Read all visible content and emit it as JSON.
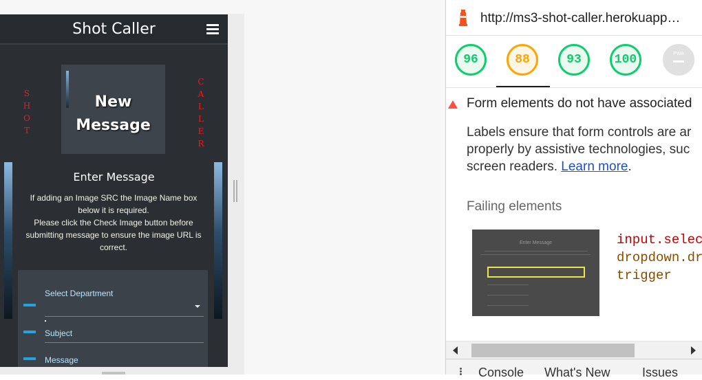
{
  "app": {
    "brand": "Shot Caller",
    "side_left": "SHOT",
    "side_right": "CALLER",
    "card_line1": "New",
    "card_line2": "Message",
    "section_title": "Enter Message",
    "help_line1": "If adding an Image SRC the Image Name box below it is required.",
    "help_line2": "Please click the Check Image button before submitting message to ensure the image URL is correct.",
    "fields": {
      "department_label": "Select Department",
      "subject_label": "Subject",
      "message_label": "Message"
    }
  },
  "lighthouse": {
    "url": "http://ms3-shot-caller.herokuapp…",
    "scores": {
      "performance": "96",
      "accessibility": "88",
      "best_practices": "93",
      "seo": "100",
      "pwa_label": "PWA"
    },
    "audit": {
      "title": "Form elements do not have associated",
      "desc_line1": "Labels ensure that form controls are ar",
      "desc_line2": "properly by assistive technologies, suc",
      "desc_line3_prefix": "screen readers. ",
      "learn_more": "Learn more",
      "desc_line3_suffix": ".",
      "failing_title": "Failing elements",
      "thumb_title": "Enter Message",
      "code_line1": "input.select",
      "code_line2": "dropdown.dro",
      "code_line3": "trigger"
    },
    "drawer_tabs": [
      "Console",
      "What's New",
      "Issues"
    ]
  },
  "colors": {
    "score_green": "#0cce6b",
    "score_orange": "#ffa400",
    "accent_blue": "#25a2e0",
    "side_text_red": "#e02020",
    "fail_red": "#ff4e42"
  }
}
